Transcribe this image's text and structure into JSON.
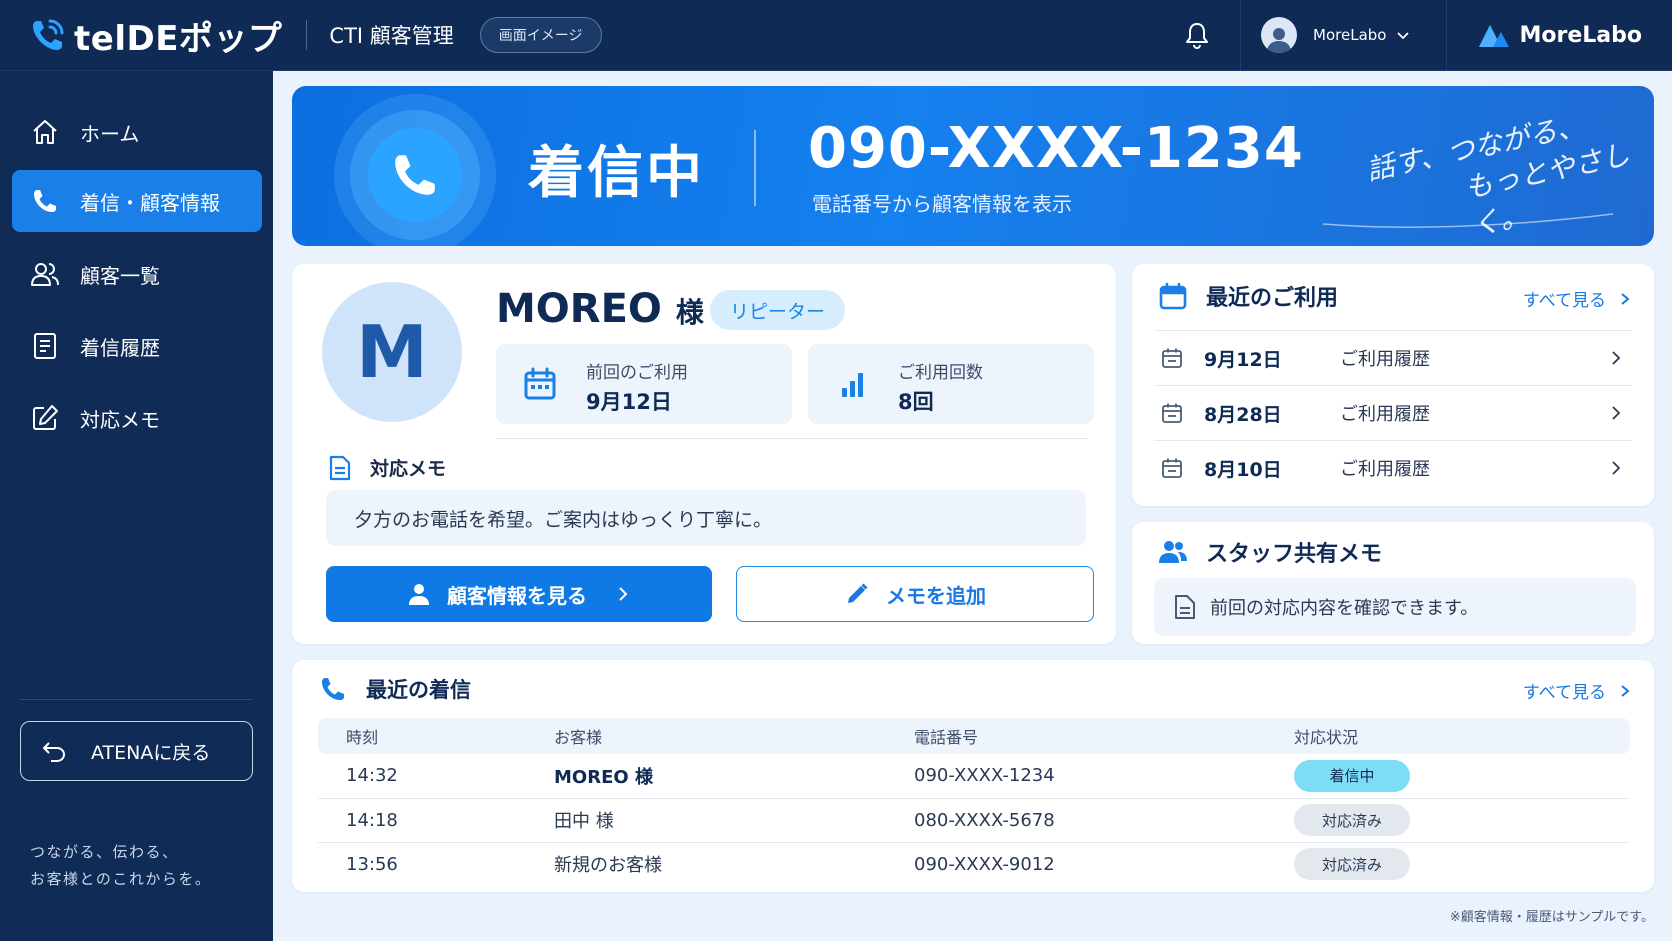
{
  "header": {
    "app_name": "telDEポップ",
    "app_title": "CTI 顧客管理",
    "mode_pill": "画面イメージ",
    "user_name": "MoreLabo",
    "brand": "MoreLabo"
  },
  "sidebar": {
    "items": [
      {
        "label": "ホーム",
        "icon": "home-icon"
      },
      {
        "label": "着信・顧客情報",
        "icon": "phone-icon",
        "active": true
      },
      {
        "label": "顧客一覧",
        "icon": "users-icon"
      },
      {
        "label": "着信履歴",
        "icon": "document-icon"
      },
      {
        "label": "対応メモ",
        "icon": "edit-icon"
      }
    ],
    "back_button": "ATENAに戻る",
    "slogan": "つながる、伝わる、\nお客様とのこれからを。"
  },
  "banner": {
    "status": "着信中",
    "phone": "090-XXXX-1234",
    "subtitle": "電話番号から顧客情報を表示",
    "tagline_1": "話す、つながる、",
    "tagline_2": "もっとやさしく。"
  },
  "customer": {
    "initial": "M",
    "name": "MOREO",
    "honorific": "様",
    "badge": "リピーター",
    "last_use_label": "前回のご利用",
    "last_use_value": "9月12日",
    "count_label": "ご利用回数",
    "count_value": "8回",
    "memo_title": "対応メモ",
    "memo_text": "夕方のお電話を希望。ご案内はゆっくり丁寧に。",
    "view_button": "顧客情報を見る",
    "add_memo_button": "メモを追加"
  },
  "recent_usage": {
    "title": "最近のご利用",
    "see_all": "すべて見る",
    "rows": [
      {
        "date": "9月12日",
        "kind": "ご利用履歴"
      },
      {
        "date": "8月28日",
        "kind": "ご利用履歴"
      },
      {
        "date": "8月10日",
        "kind": "ご利用履歴"
      }
    ]
  },
  "staff_memo": {
    "title": "スタッフ共有メモ",
    "text": "前回の対応内容を確認できます。"
  },
  "recent_calls": {
    "title": "最近の着信",
    "see_all": "すべて見る",
    "columns": [
      "時刻",
      "お客様",
      "電話番号",
      "対応状況"
    ],
    "rows": [
      {
        "time": "14:32",
        "customer": "MOREO 様",
        "phone": "090-XXXX-1234",
        "status": "着信中"
      },
      {
        "time": "14:18",
        "customer": "田中 様",
        "phone": "080-XXXX-5678",
        "status": "対応済み"
      },
      {
        "time": "13:56",
        "customer": "新規のお客様",
        "phone": "090-XXXX-9012",
        "status": "対応済み"
      }
    ]
  },
  "footnote": "※顧客情報・履歴はサンプルです。",
  "colors": {
    "navy": "#0e2a55",
    "accent": "#1a7fe6",
    "active_status": "#7fdcf5",
    "done_status": "#e3e8ef"
  }
}
